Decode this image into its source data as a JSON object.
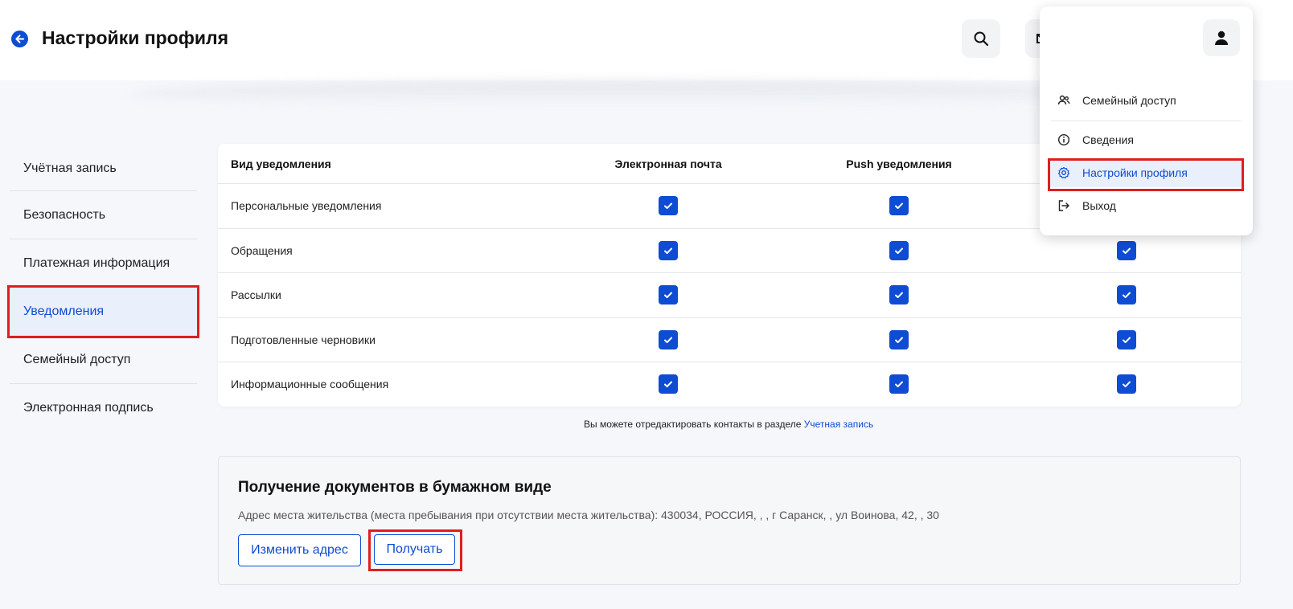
{
  "header": {
    "title": "Настройки профиля"
  },
  "sidebar": {
    "items": [
      {
        "label": "Учётная запись"
      },
      {
        "label": "Безопасность"
      },
      {
        "label": "Платежная информация"
      },
      {
        "label": "Уведомления",
        "active": true
      },
      {
        "label": "Семейный доступ"
      },
      {
        "label": "Электронная подпись"
      }
    ]
  },
  "notifications": {
    "columns": [
      "Вид уведомления",
      "Электронная почта",
      "Push уведомления"
    ],
    "rows": [
      {
        "label": "Персональные уведомления",
        "email": true,
        "push": true,
        "third": true
      },
      {
        "label": "Обращения",
        "email": true,
        "push": true,
        "third": true
      },
      {
        "label": "Рассылки",
        "email": true,
        "push": true,
        "third": true
      },
      {
        "label": "Подготовленные черновики",
        "email": true,
        "push": true,
        "third": true
      },
      {
        "label": "Информационные сообщения",
        "email": true,
        "push": true,
        "third": true
      }
    ]
  },
  "note": {
    "text": "Вы можете отредактировать контакты в разделе",
    "link": "Учетная запись"
  },
  "paper": {
    "title": "Получение документов в бумажном виде",
    "address": "Адрес места жительства (места пребывания при отсутствии места жительства): 430034, РОССИЯ, , , г Саранск, , ул Воинова, 42, , 30",
    "change_button": "Изменить адрес",
    "receive_button": "Получать"
  },
  "dropdown": {
    "items": [
      {
        "label": "Семейный доступ",
        "icon": "family-icon"
      },
      {
        "label": "Сведения",
        "icon": "info-icon"
      },
      {
        "label": "Настройки профиля",
        "icon": "gear-icon",
        "active": true
      },
      {
        "label": "Выход",
        "icon": "logout-icon"
      }
    ]
  },
  "colors": {
    "accent": "#0d4cd3",
    "highlight": "#e01e1e",
    "active_bg": "#e9effb"
  }
}
